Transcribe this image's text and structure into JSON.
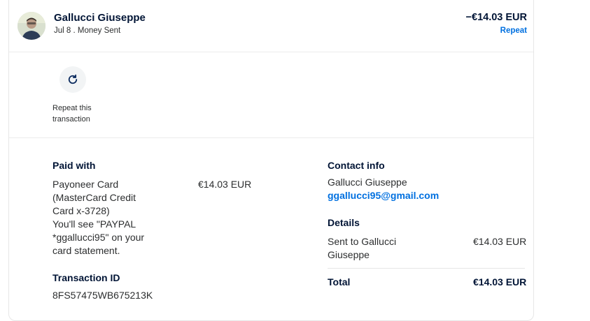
{
  "transaction": {
    "name": "Gallucci Giuseppe",
    "date": "Jul 8 . Money Sent",
    "amount": "−€14.03 EUR",
    "repeat_link": "Repeat"
  },
  "action": {
    "repeat_label": "Repeat this transaction"
  },
  "paid_with": {
    "heading": "Paid with",
    "method_line1": "Payoneer Card",
    "method_line2": "(MasterCard Credit",
    "method_line3": "Card x-3728)",
    "note_line1": "You'll see \"PAYPAL",
    "note_line2": "*ggallucci95\" on your",
    "note_line3": "card statement.",
    "amount": "€14.03 EUR"
  },
  "transaction_id": {
    "heading": "Transaction ID",
    "value": "8FS57475WB675213K"
  },
  "contact": {
    "heading": "Contact info",
    "name": "Gallucci Giuseppe",
    "email": "ggallucci95@gmail.com"
  },
  "details": {
    "heading": "Details",
    "sent_to_line1": "Sent to Gallucci",
    "sent_to_line2": "Giuseppe",
    "sent_amount": "€14.03 EUR",
    "total_label": "Total",
    "total_amount": "€14.03 EUR"
  },
  "colors": {
    "link": "#0070e0",
    "text": "#001435"
  },
  "icons": {
    "repeat": "refresh-icon",
    "avatar": "profile-photo"
  }
}
